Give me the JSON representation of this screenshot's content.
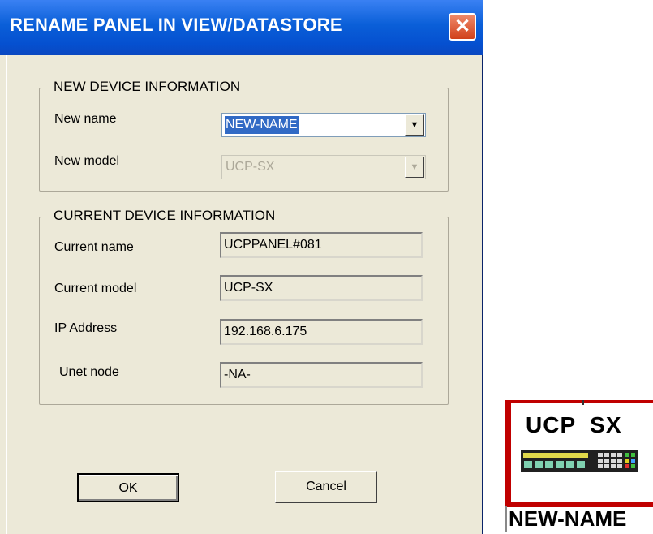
{
  "dialog": {
    "title": "RENAME PANEL IN VIEW/DATASTORE",
    "close_glyph": "✕"
  },
  "new_device": {
    "legend": "NEW DEVICE INFORMATION",
    "name_label": "New name",
    "name_value": "NEW-NAME",
    "model_label": "New model",
    "model_value": "UCP-SX"
  },
  "current_device": {
    "legend": "CURRENT DEVICE INFORMATION",
    "name_label": "Current name",
    "name_value": "UCPPANEL#081",
    "model_label": "Current model",
    "model_value": "UCP-SX",
    "ip_label": "IP Address",
    "ip_value": "192.168.6.175",
    "unet_label": "Unet node",
    "unet_value": "-NA-"
  },
  "buttons": {
    "ok": "OK",
    "cancel": "Cancel"
  },
  "preview": {
    "model_text": "UCP  SX",
    "panel_name": "NEW-NAME",
    "icon": "ucp-sx-device-icon"
  },
  "colors": {
    "title_bar": "#0a5fd8",
    "close_button": "#d0401a",
    "selection": "#316ac5",
    "panel_border": "#c00000",
    "dialog_bg": "#ece9d8"
  }
}
